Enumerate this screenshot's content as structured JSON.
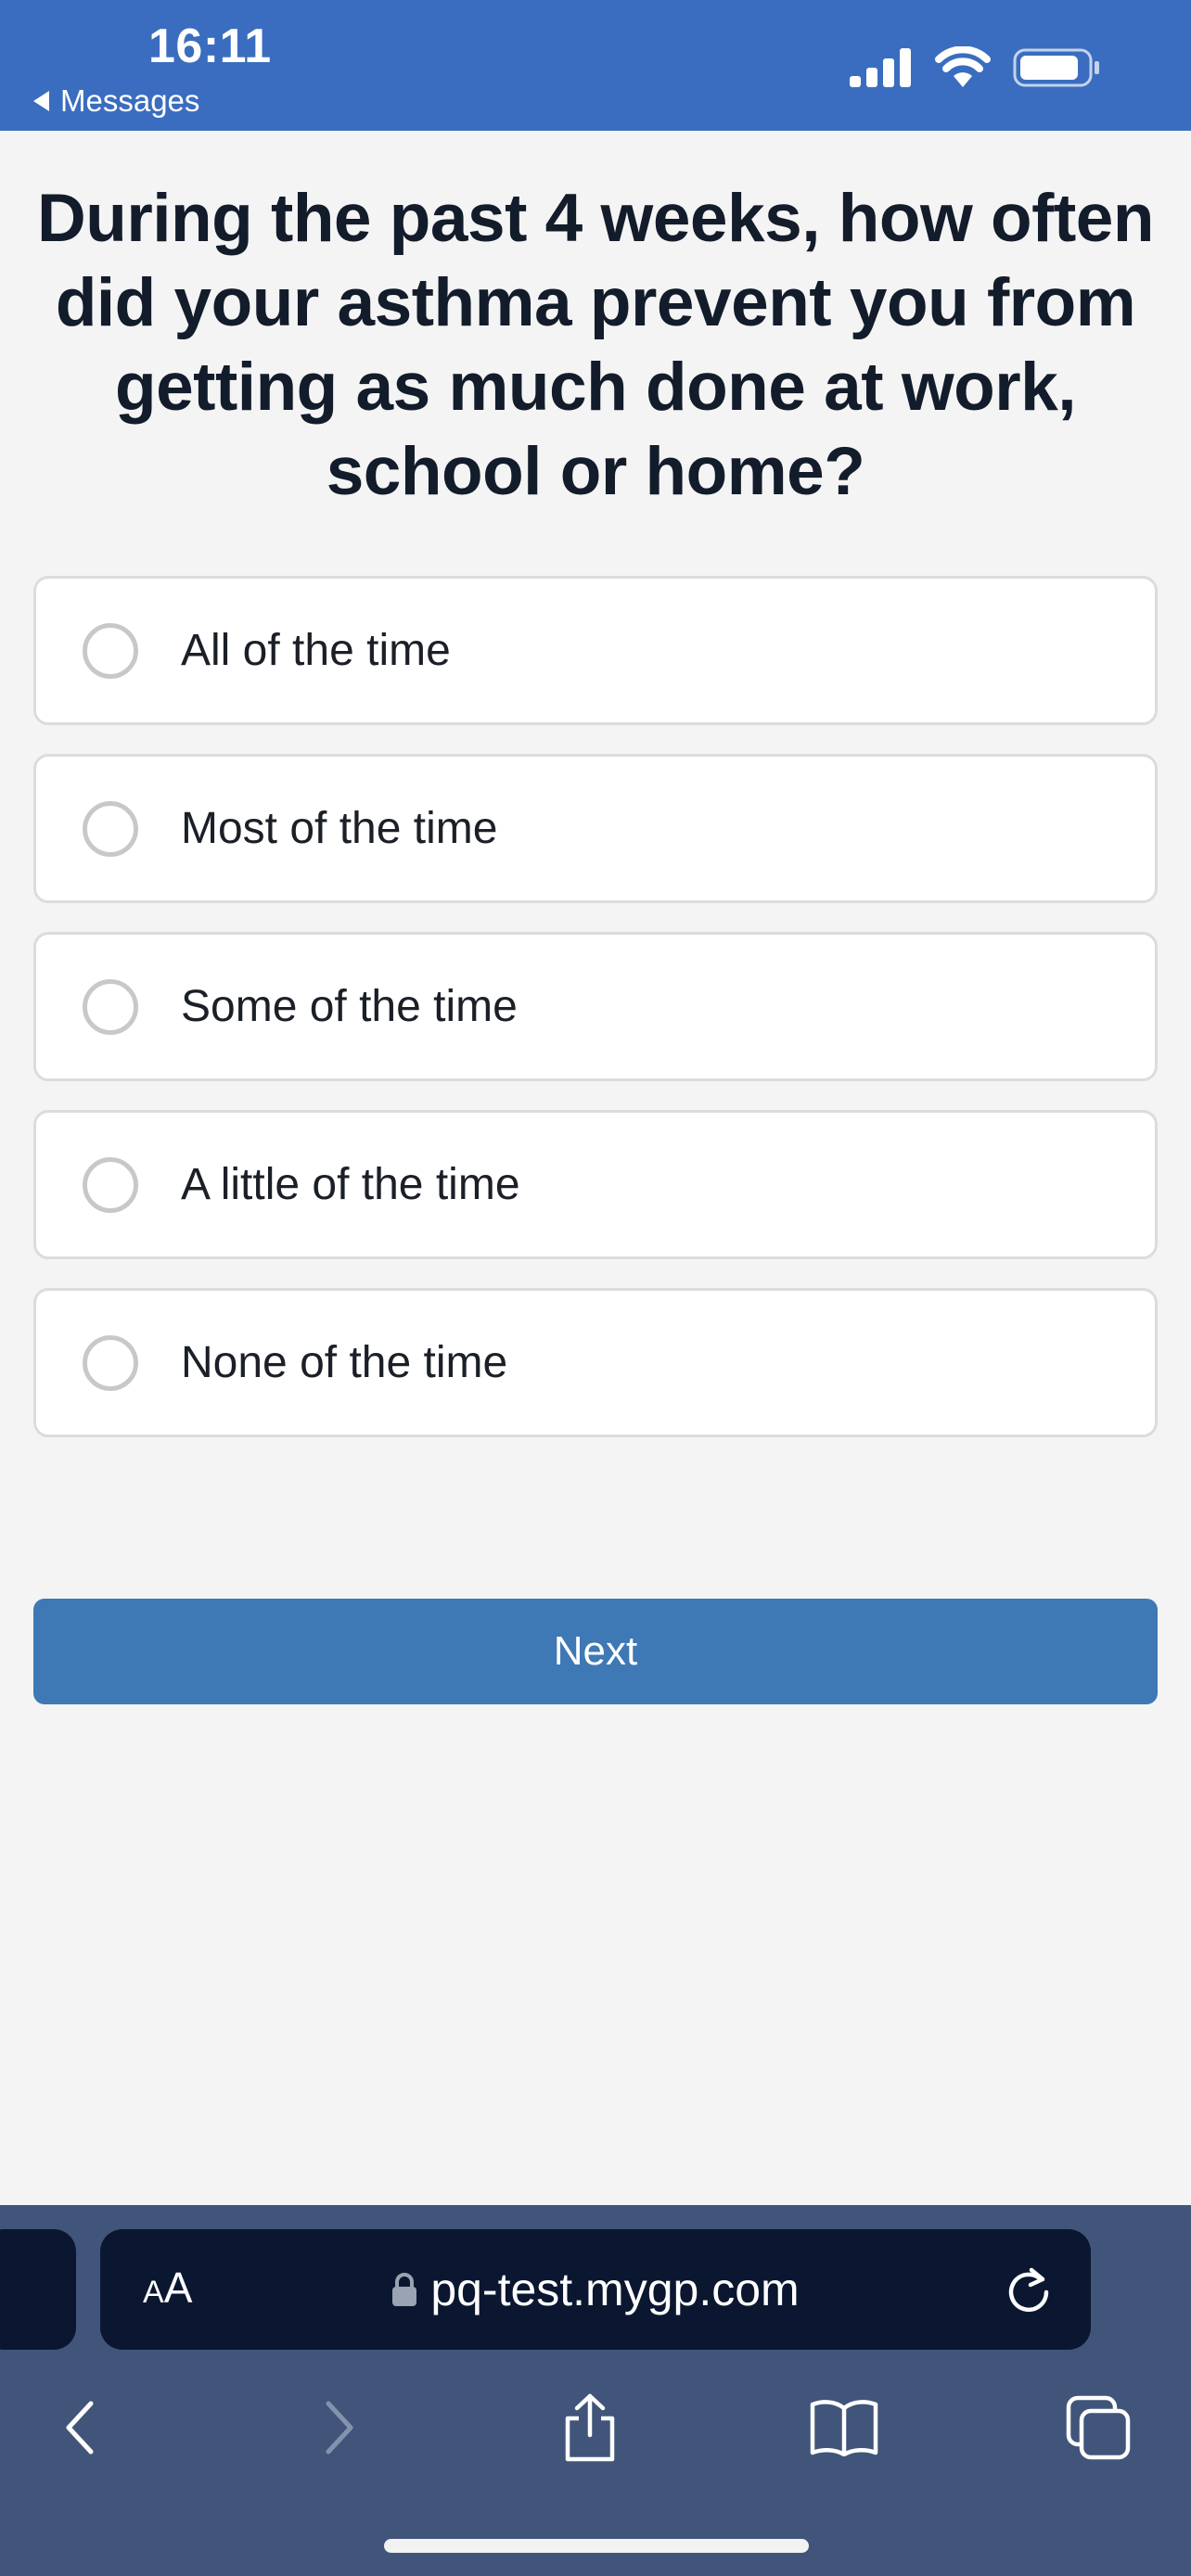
{
  "status_bar": {
    "time": "16:11",
    "back_label": "Messages",
    "background_color": "#3a6dbf",
    "icons": [
      "signal-icon",
      "wifi-icon",
      "battery-icon"
    ]
  },
  "question": {
    "text": "During the past 4 weeks, how often did your asthma prevent you from getting as much done at work, school or home?"
  },
  "options": [
    {
      "label": "All of the time",
      "selected": false
    },
    {
      "label": "Most of the time",
      "selected": false
    },
    {
      "label": "Some of the time",
      "selected": false
    },
    {
      "label": "A little of the time",
      "selected": false
    },
    {
      "label": "None of the time",
      "selected": false
    }
  ],
  "next_button": {
    "label": "Next",
    "color": "#3e78b5"
  },
  "browser": {
    "text_size_small": "A",
    "text_size_large": "A",
    "url": "pq-test.mygp.com",
    "icons": [
      "back-icon",
      "forward-icon",
      "share-icon",
      "bookmarks-icon",
      "tabs-icon",
      "reload-icon",
      "lock-icon"
    ]
  }
}
